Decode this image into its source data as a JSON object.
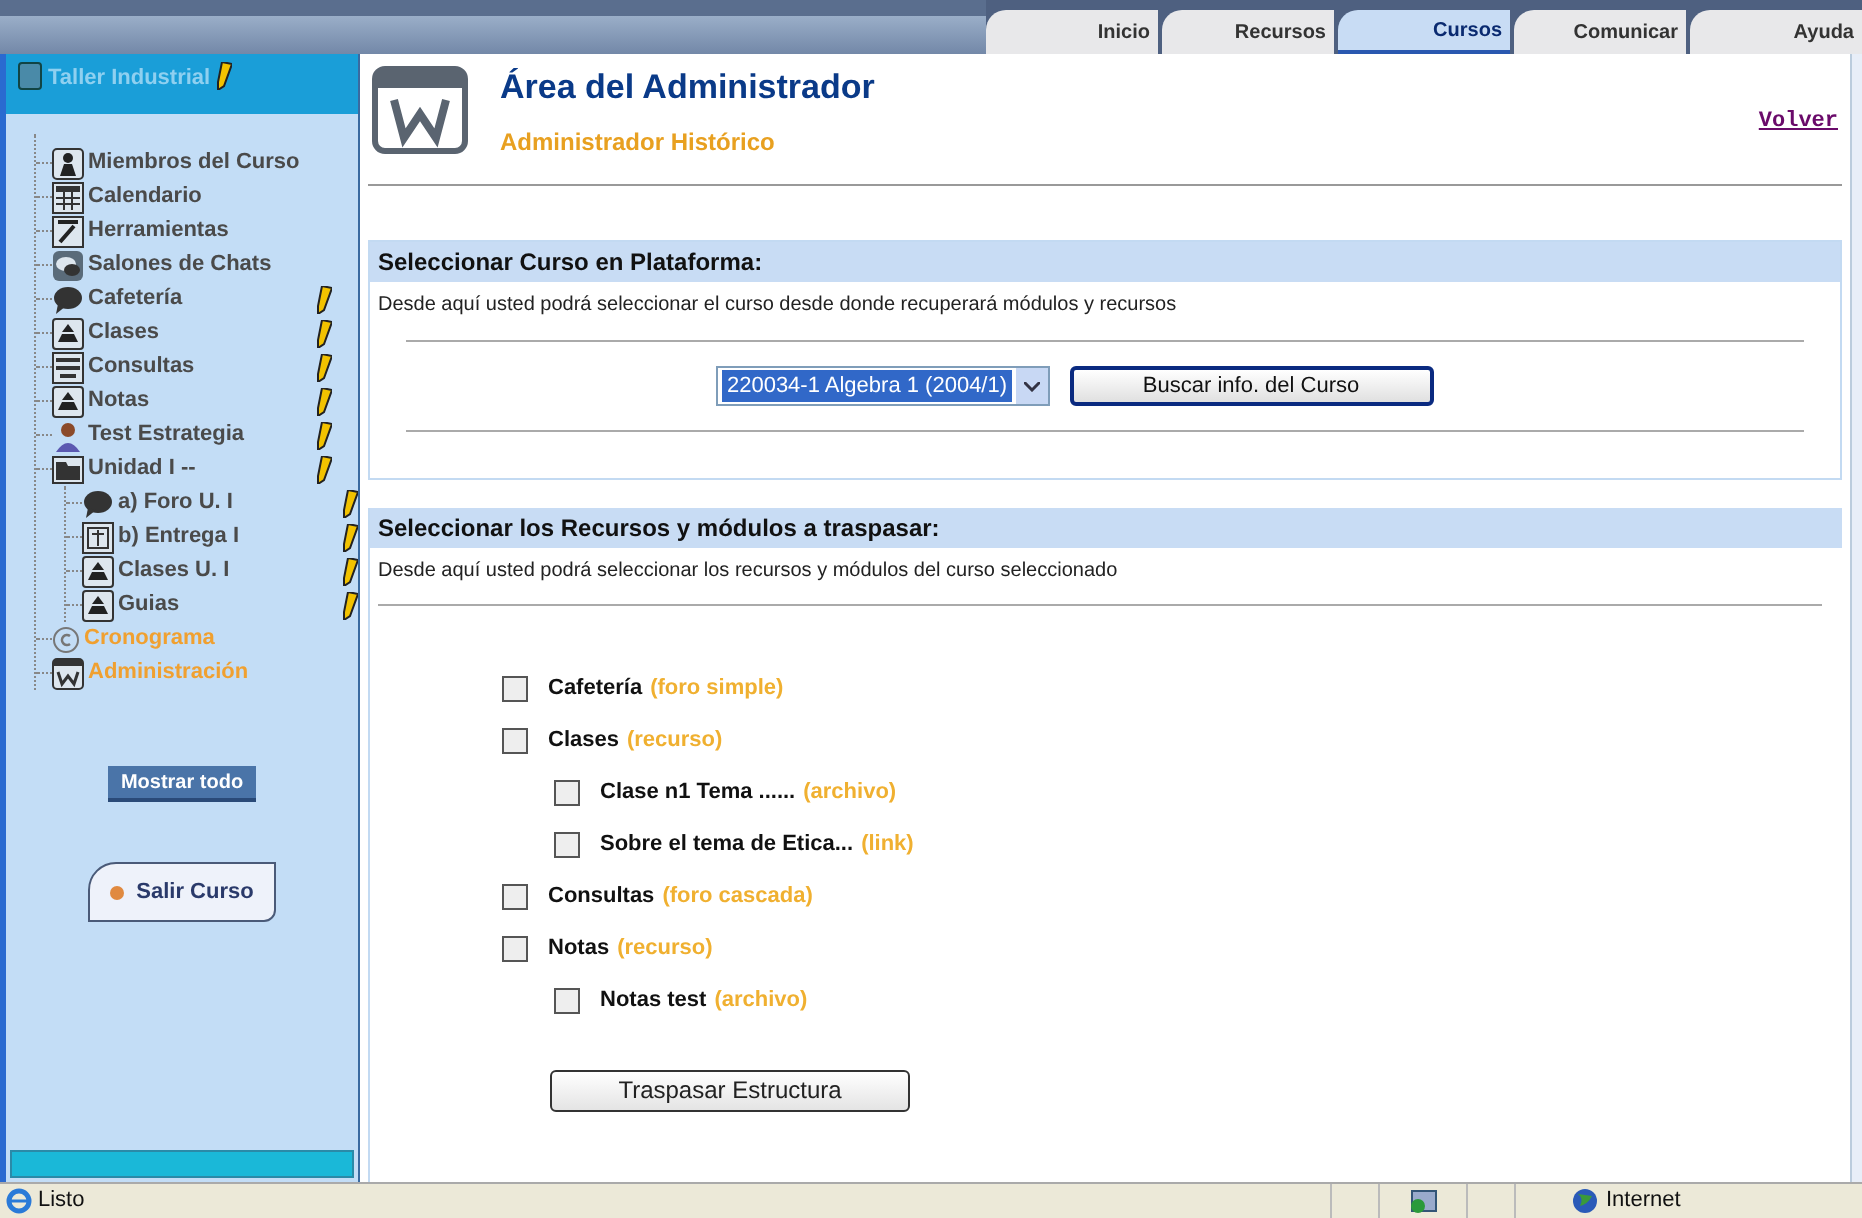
{
  "tabs": [
    {
      "label": "Inicio",
      "selected": false
    },
    {
      "label": "Recursos",
      "selected": false
    },
    {
      "label": "Cursos",
      "selected": true
    },
    {
      "label": "Comunicar",
      "selected": false
    },
    {
      "label": "Ayuda",
      "selected": false
    }
  ],
  "sidebar": {
    "course_title": "Taller Industrial",
    "items": [
      {
        "label": "Miembros del Curso",
        "kind": "person",
        "editable": false,
        "accent": false
      },
      {
        "label": "Calendario",
        "kind": "calendar",
        "editable": false,
        "accent": false
      },
      {
        "label": "Herramientas",
        "kind": "tools",
        "editable": false,
        "accent": false
      },
      {
        "label": "Salones de Chats",
        "kind": "chat",
        "editable": false,
        "accent": false
      },
      {
        "label": "Cafetería",
        "kind": "bubble",
        "editable": true,
        "accent": false
      },
      {
        "label": "Clases",
        "kind": "resource",
        "editable": true,
        "accent": false
      },
      {
        "label": "Consultas",
        "kind": "list",
        "editable": true,
        "accent": false
      },
      {
        "label": "Notas",
        "kind": "resource",
        "editable": true,
        "accent": false
      },
      {
        "label": "Test Estrategia",
        "kind": "user",
        "editable": true,
        "accent": false
      },
      {
        "label": "Unidad I --",
        "kind": "folder",
        "editable": true,
        "accent": false,
        "children": [
          {
            "label": "a) Foro U. I",
            "kind": "bubble",
            "editable": true,
            "accent": false
          },
          {
            "label": "b) Entrega I",
            "kind": "upload",
            "editable": true,
            "accent": false
          },
          {
            "label": "Clases U. I",
            "kind": "resource",
            "editable": true,
            "accent": false
          },
          {
            "label": "Guias",
            "kind": "resource",
            "editable": true,
            "accent": false
          }
        ]
      },
      {
        "label": "Cronograma",
        "kind": "copyright",
        "editable": false,
        "accent": true
      },
      {
        "label": "Administración",
        "kind": "w",
        "editable": false,
        "accent": true
      }
    ],
    "show_all_button": "Mostrar todo",
    "exit_button": "Salir Curso"
  },
  "header": {
    "title": "Área del Administrador",
    "subtitle": "Administrador Histórico",
    "back_link": "Volver"
  },
  "course_section": {
    "heading": "Seleccionar Curso en Plataforma:",
    "description": "Desde aquí usted podrá seleccionar el curso desde donde recuperará módulos y recursos",
    "course_select": "220034-1 Algebra 1 (2004/1)",
    "search_button": "Buscar info. del Curso"
  },
  "resources_section": {
    "heading": "Seleccionar los Recursos y módulos a traspasar:",
    "description": "Desde aquí usted podrá seleccionar los recursos y módulos del curso seleccionado",
    "items": [
      {
        "label": "Cafetería",
        "type": "(foro simple)",
        "checked": false
      },
      {
        "label": "Clases",
        "type": "(recurso)",
        "checked": false,
        "children": [
          {
            "label": "Clase n1 Tema ......",
            "type": "(archivo)",
            "checked": false
          },
          {
            "label": "Sobre el tema de Etica...",
            "type": "(link)",
            "checked": false
          }
        ]
      },
      {
        "label": "Consultas",
        "type": "(foro cascada)",
        "checked": false
      },
      {
        "label": "Notas",
        "type": "(recurso)",
        "checked": false,
        "children": [
          {
            "label": "Notas test",
            "type": "(archivo)",
            "checked": false
          }
        ]
      }
    ],
    "submit_button": "Traspasar Estructura"
  },
  "status_bar": {
    "status": "Listo",
    "zone": "Internet"
  }
}
